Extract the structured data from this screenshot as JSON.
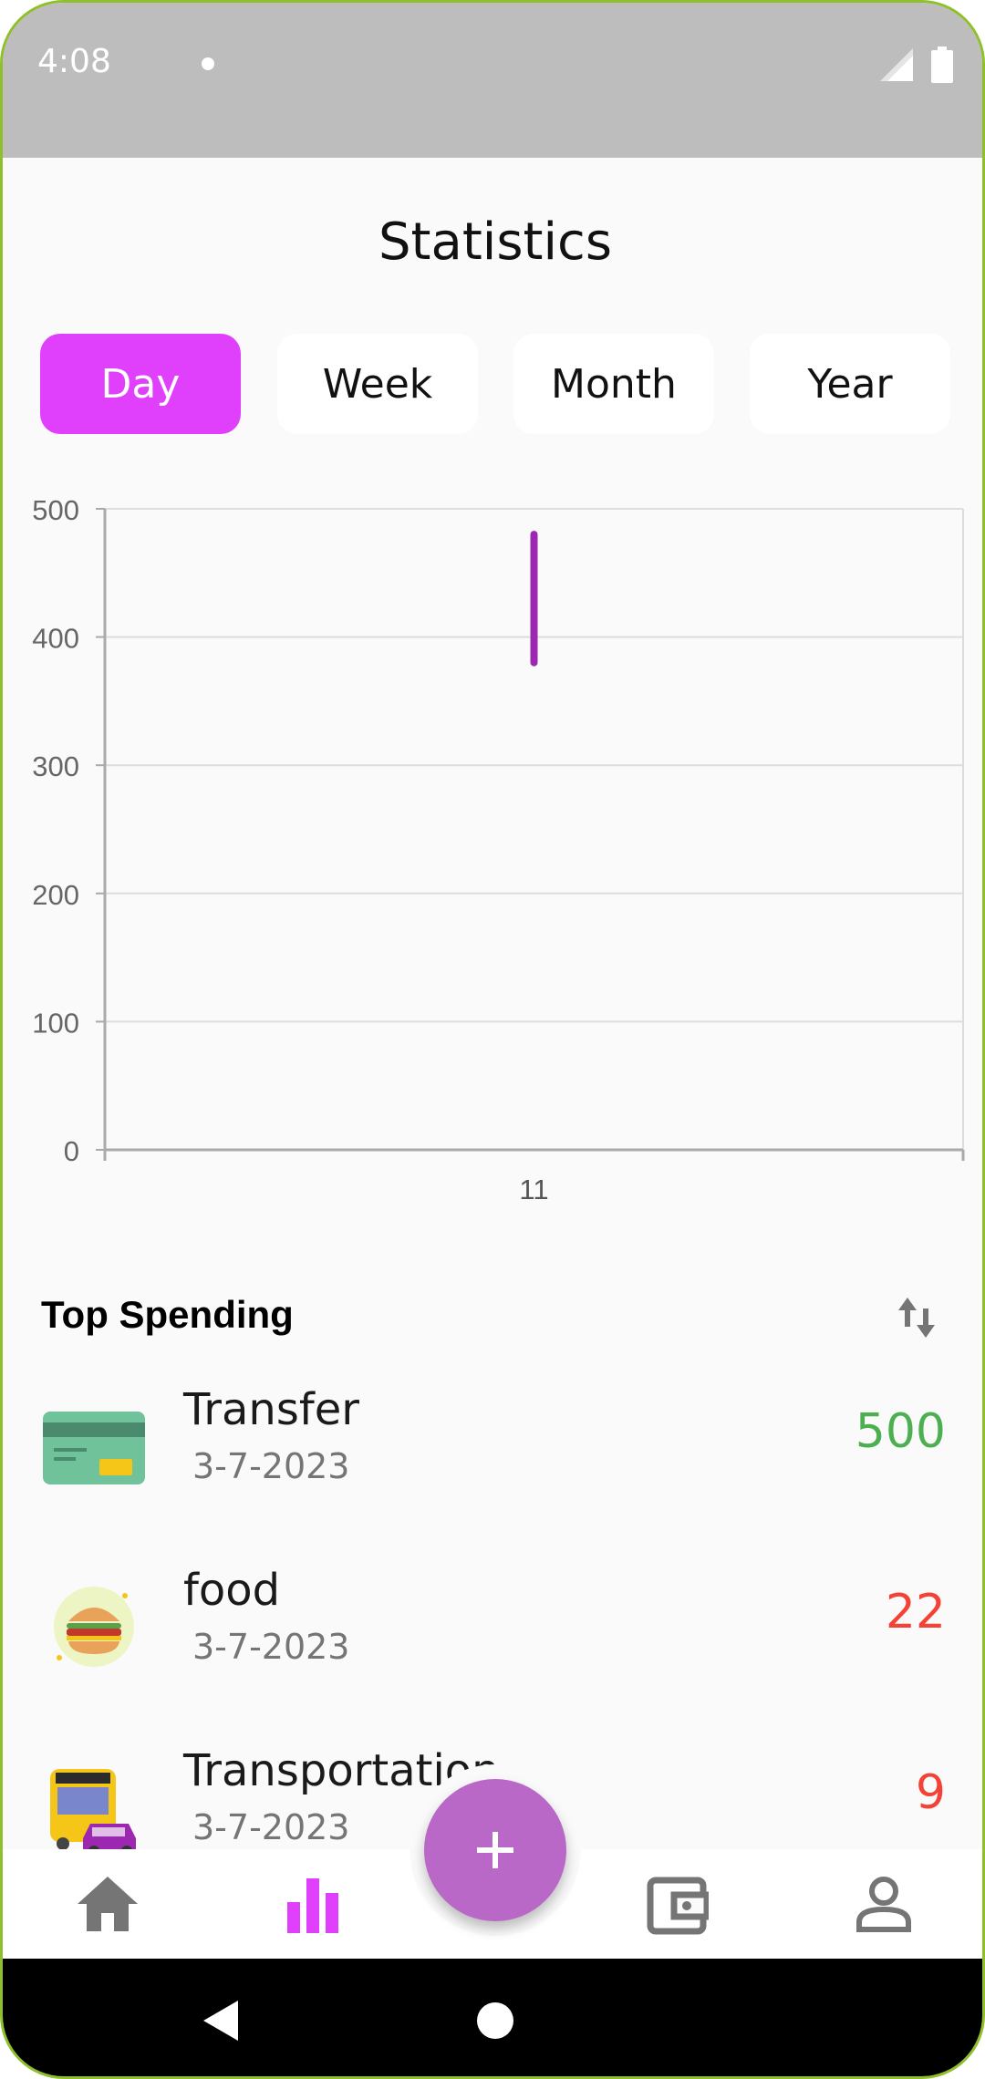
{
  "status_bar": {
    "time": "4:08"
  },
  "page": {
    "title": "Statistics"
  },
  "tabs": [
    {
      "label": "Day",
      "active": true
    },
    {
      "label": "Week",
      "active": false
    },
    {
      "label": "Month",
      "active": false
    },
    {
      "label": "Year",
      "active": false
    }
  ],
  "chart_data": {
    "type": "candlestick",
    "categories": [
      "11"
    ],
    "series": [
      {
        "low": 380,
        "high": 480,
        "color": "#9c27b0"
      }
    ],
    "ylim": [
      0,
      500
    ],
    "yticks": [
      "0",
      "100",
      "200",
      "300",
      "400",
      "500"
    ],
    "grid": true
  },
  "top_spending": {
    "title": "Top Spending",
    "items": [
      {
        "name": "Transfer",
        "date": "3-7-2023",
        "amount": "500",
        "amount_color": "#4caf50",
        "icon": "credit-card-icon"
      },
      {
        "name": "food",
        "date": "3-7-2023",
        "amount": "22",
        "amount_color": "#f44336",
        "icon": "burger-icon"
      },
      {
        "name": "Transportation",
        "date": "3-7-2023",
        "amount": "9",
        "amount_color": "#f44336",
        "icon": "bus-icon"
      }
    ]
  },
  "colors": {
    "accent": "#e040fb",
    "fab": "#ba68c8",
    "positive": "#4caf50",
    "negative": "#f44336"
  }
}
